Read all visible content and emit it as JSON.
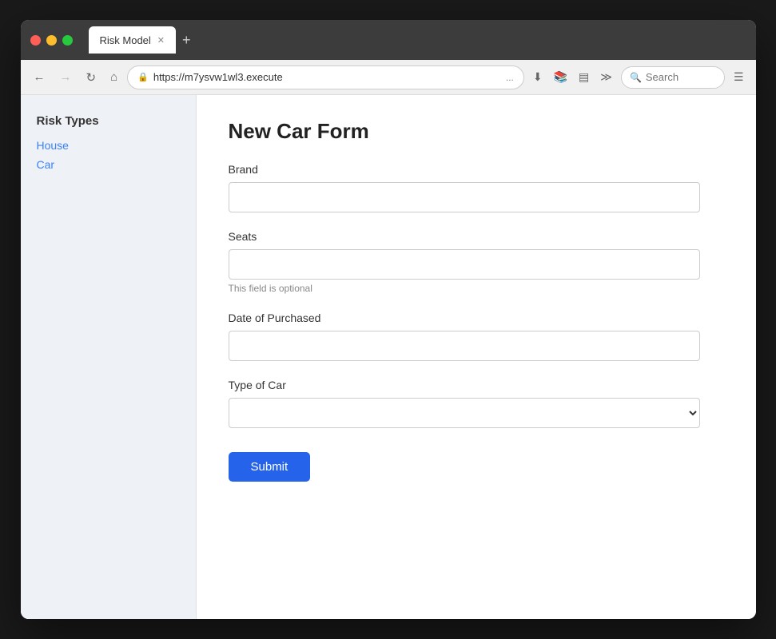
{
  "browser": {
    "tab_title": "Risk Model",
    "url": "https://m7ysvw1wl3.execute",
    "url_dots": "...",
    "search_placeholder": "Search",
    "new_tab_icon": "+",
    "back_disabled": false
  },
  "sidebar": {
    "title": "Risk Types",
    "links": [
      {
        "label": "House",
        "id": "house"
      },
      {
        "label": "Car",
        "id": "car"
      }
    ]
  },
  "form": {
    "title": "New Car Form",
    "fields": {
      "brand": {
        "label": "Brand",
        "type": "text",
        "value": "",
        "placeholder": ""
      },
      "seats": {
        "label": "Seats",
        "type": "number",
        "value": "",
        "hint": "This field is optional"
      },
      "date_of_purchased": {
        "label": "Date of Purchased",
        "type": "text",
        "value": "",
        "placeholder": ""
      },
      "type_of_car": {
        "label": "Type of Car",
        "type": "select",
        "value": "",
        "options": [
          ""
        ]
      }
    },
    "submit_label": "Submit"
  }
}
